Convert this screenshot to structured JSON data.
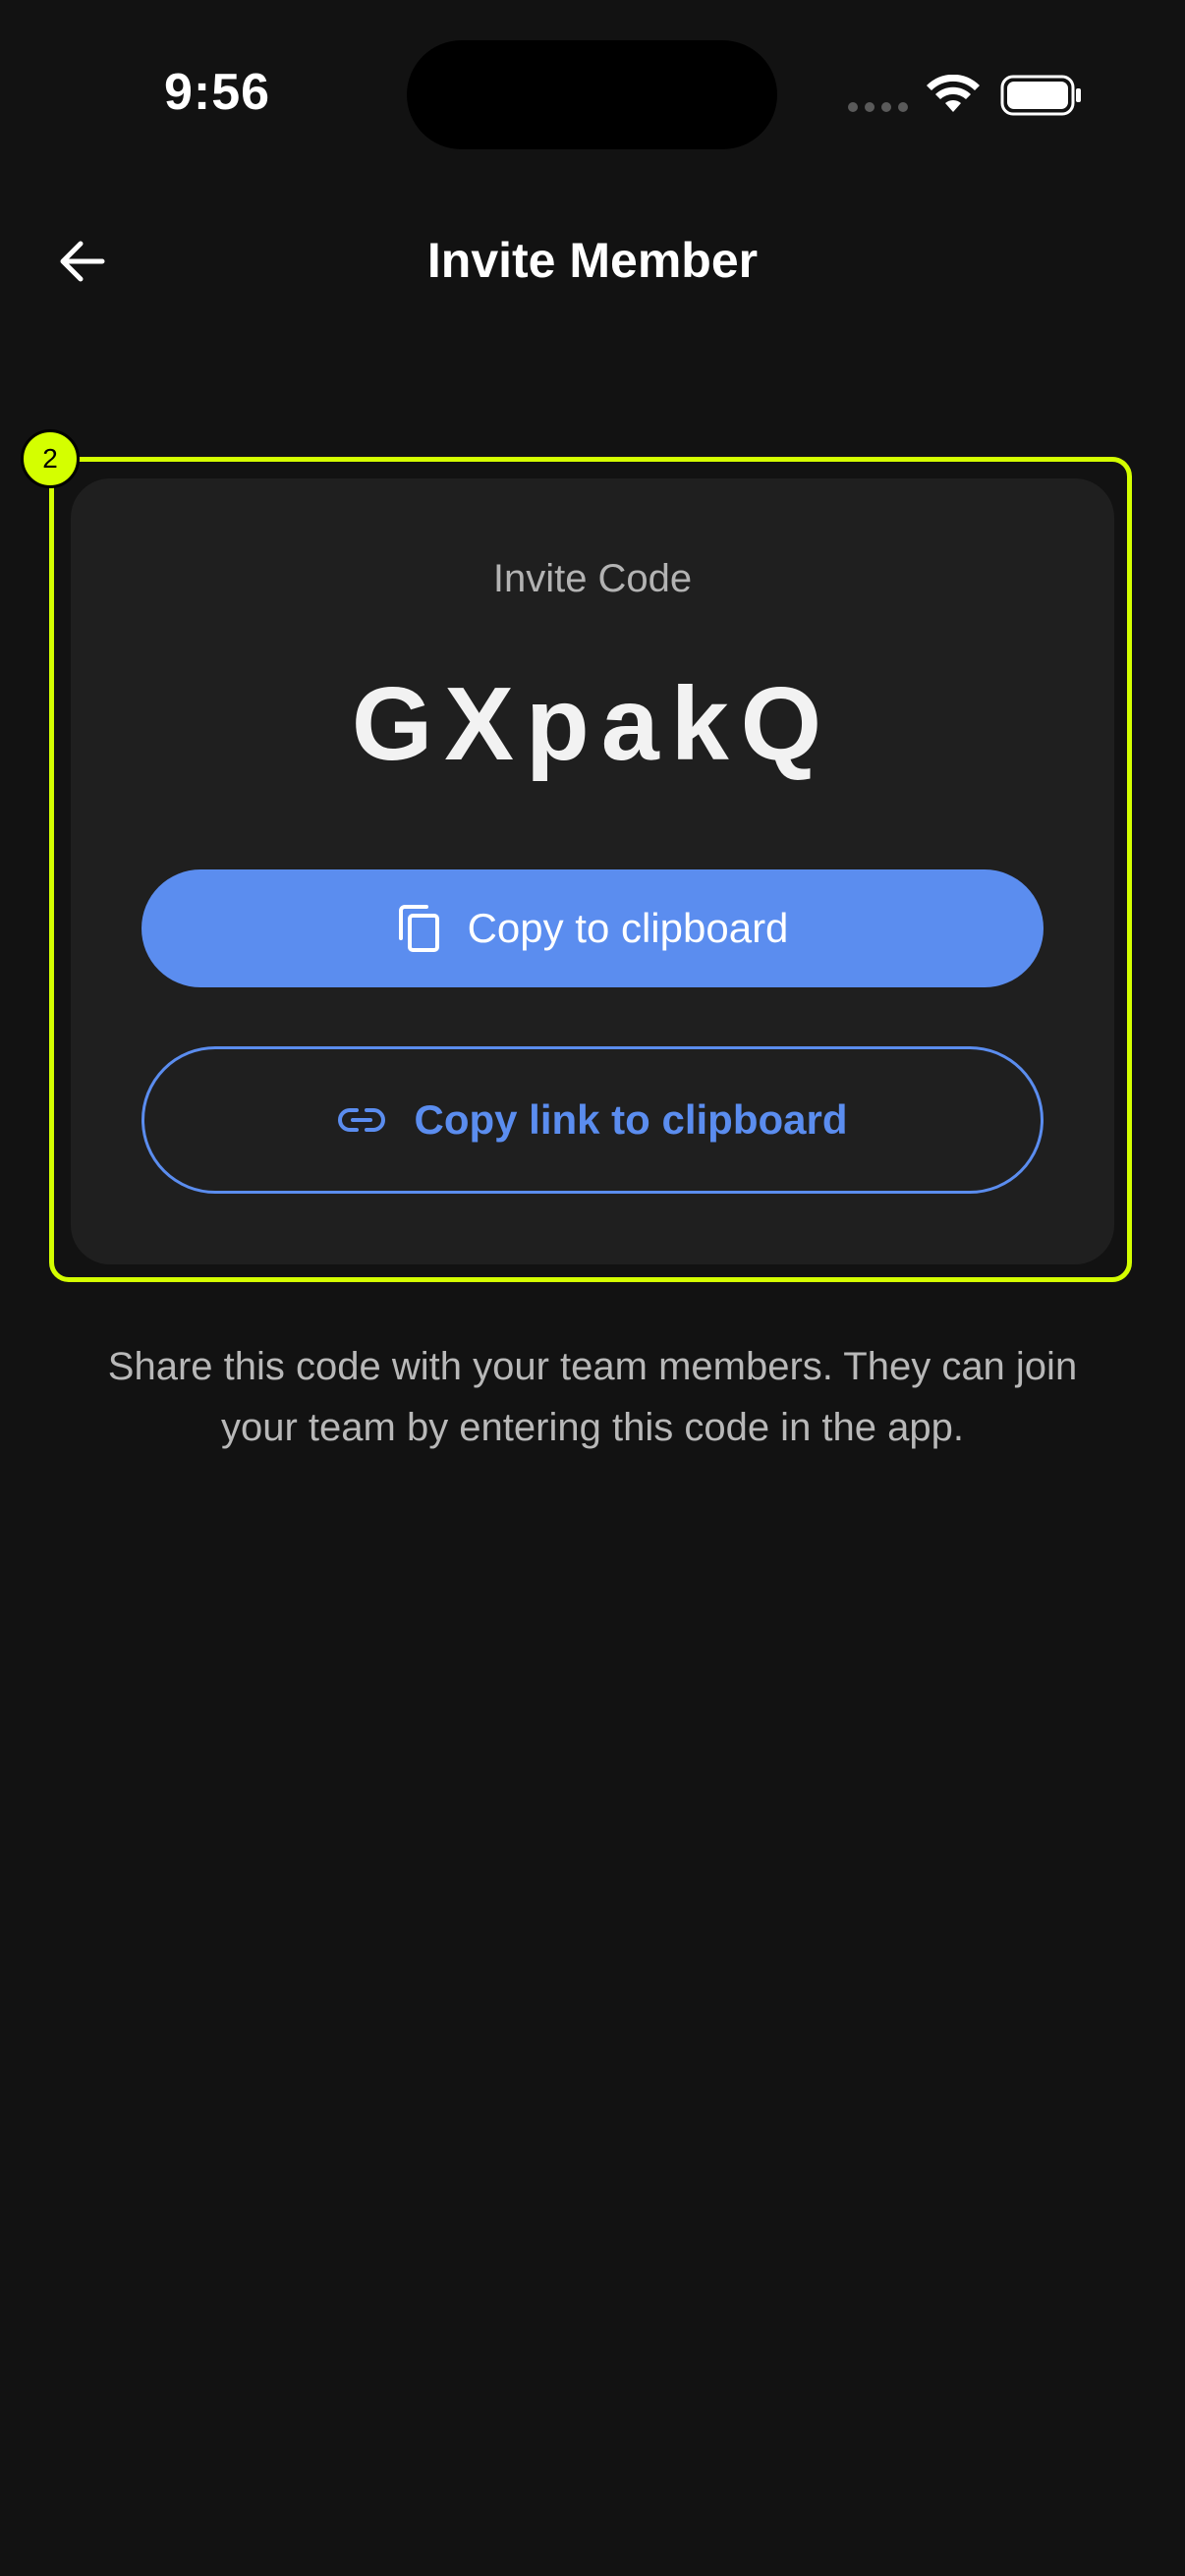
{
  "status_bar": {
    "time": "9:56"
  },
  "header": {
    "title": "Invite Member",
    "back_icon": "arrow-left-icon"
  },
  "overlay": {
    "badge_number": "2",
    "highlight_color": "#d4ff00"
  },
  "invite_card": {
    "label": "Invite Code",
    "code": "GXpakQ",
    "copy_button": {
      "label": "Copy to clipboard",
      "icon": "copy-icon",
      "color": "#5b8def"
    },
    "copy_link_button": {
      "label": "Copy link to clipboard",
      "icon": "link-icon",
      "color": "#5b8def"
    }
  },
  "description": "Share this code with your team members. They can join your team by entering this code in the app.",
  "colors": {
    "background": "#121212",
    "card": "#1f1f1f",
    "accent": "#5b8def"
  }
}
